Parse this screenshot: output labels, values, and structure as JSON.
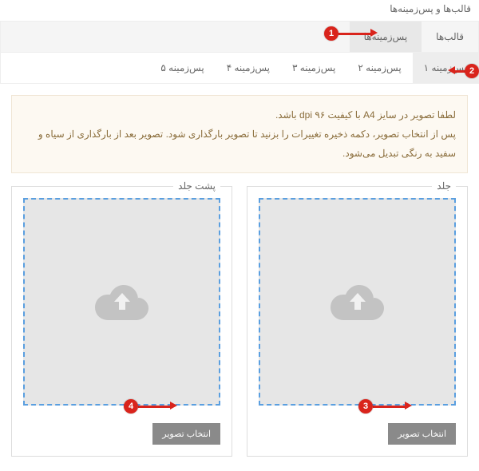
{
  "header": {
    "title": "قالب‌ها و پس‌زمینه‌ها"
  },
  "tabs": {
    "items": [
      {
        "label": "قالب‌ها"
      },
      {
        "label": "پس‌زمینه‌ها"
      }
    ]
  },
  "subTabs": {
    "items": [
      {
        "label": "پس‌زمینه ۱"
      },
      {
        "label": "پس‌زمینه ۲"
      },
      {
        "label": "پس‌زمینه ۳"
      },
      {
        "label": "پس‌زمینه ۴"
      },
      {
        "label": "پس‌زمینه ۵"
      }
    ]
  },
  "notice": {
    "line1": "لطفا تصویر در سایز A4 با کیفیت ۹۶ dpi باشد.",
    "line2": "پس از انتخاب تصویر، دکمه ذخیره تغییرات را بزنید تا تصویر بارگذاری شود. تصویر بعد از بارگذاری از سیاه و سفید به رنگی تبدیل می‌شود."
  },
  "panels": {
    "cover": {
      "title": "جلد",
      "button": "انتخاب تصویر"
    },
    "backCover": {
      "title": "پشت جلد",
      "button": "انتخاب تصویر"
    }
  },
  "markers": {
    "m1": "1",
    "m2": "2",
    "m3": "3",
    "m4": "4"
  }
}
